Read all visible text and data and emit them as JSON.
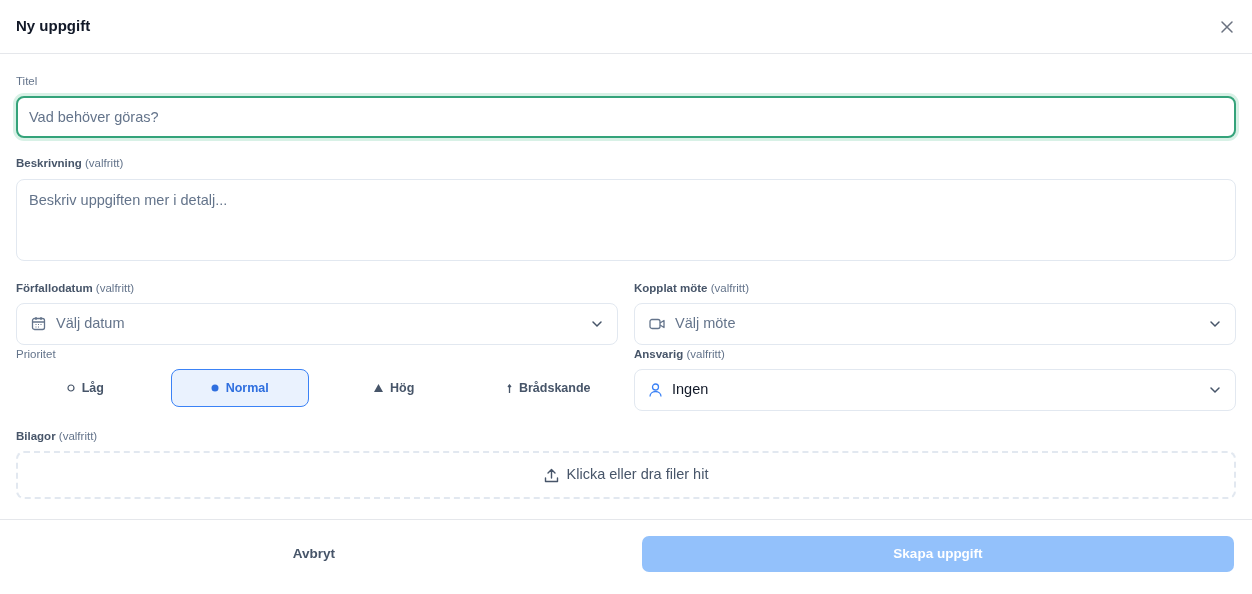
{
  "dialog": {
    "title": "Ny uppgift"
  },
  "fields": {
    "title": {
      "label": "Titel",
      "placeholder": "Vad behöver göras?",
      "focused": true
    },
    "description": {
      "label": "**Beskrivning** (valfritt)",
      "placeholder": "Beskriv uppgiften mer i detalj..."
    },
    "due_date": {
      "label": "**Förfallodatum** (valfritt)",
      "placeholder": "Välj datum"
    },
    "meeting": {
      "label": "**Kopplat möte** (valfritt)",
      "placeholder": "Välj möte"
    },
    "priority": {
      "label": "Prioritet",
      "options": [
        {
          "label": "Låg",
          "kind": "low",
          "selected": false
        },
        {
          "label": "Normal",
          "kind": "normal",
          "selected": true
        },
        {
          "label": "Hög",
          "kind": "high",
          "selected": false
        },
        {
          "label": "Brådskande",
          "kind": "urgent",
          "selected": false
        }
      ]
    },
    "assignee": {
      "label": "**Ansvarig** (valfritt)",
      "value": "Ingen"
    },
    "attachments": {
      "label": "**Bilagor** (valfritt)",
      "prompt": "Klicka eller dra filer hit"
    }
  },
  "footer": {
    "cancel": "Avbryt",
    "submit": {
      "label": "Skapa uppgift",
      "disabled": true
    }
  }
}
